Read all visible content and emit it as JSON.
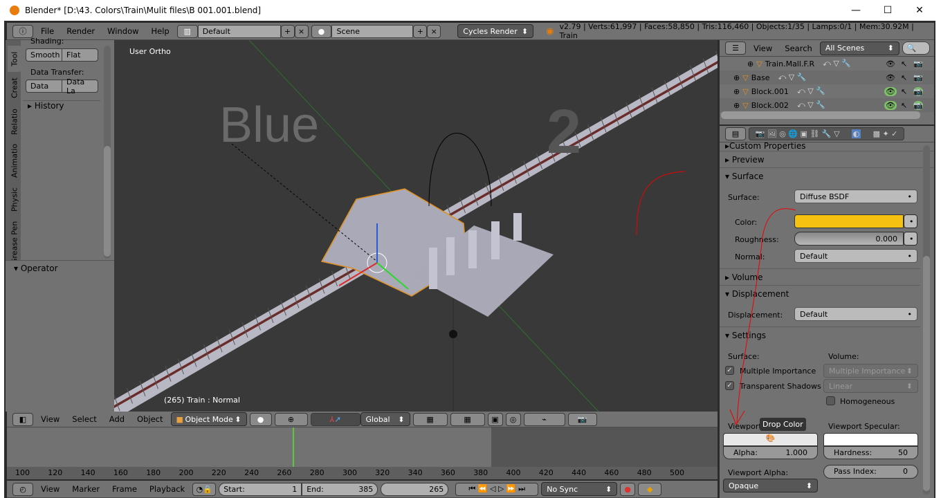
{
  "window": {
    "title": "Blender* [D:\\43. Colors\\Train\\Mulit files\\B 001.001.blend]",
    "minimize": "—",
    "maximize": "☐",
    "close": "✕"
  },
  "info_header": {
    "menus": [
      "File",
      "Render",
      "Window",
      "Help"
    ],
    "layout": "Default",
    "scene": "Scene",
    "engine": "Cycles Render",
    "stats": "v2.79 | Verts:61,997 | Faces:58,850 | Tris:116,460 | Objects:1/35 | Lamps:0/1 | Mem:30.92M | Train"
  },
  "tool_shelf": {
    "tabs": [
      "Tool",
      "Creat",
      "Relatio",
      "Animatio",
      "Physic",
      "Grease Pen"
    ],
    "shading_label": "Shading:",
    "smooth": "Smooth",
    "flat": "Flat",
    "data_transfer_label": "Data Transfer:",
    "data": "Data",
    "data_layers": "Data La",
    "history": "History",
    "operator": "Operator"
  },
  "viewport": {
    "view_label": "User Ortho",
    "object_label": "(265) Train : Normal",
    "text_blue": "Blue",
    "text_num": "2"
  },
  "view3d_header": {
    "menus": [
      "View",
      "Select",
      "Add",
      "Object"
    ],
    "mode": "Object Mode",
    "orientation": "Global"
  },
  "timeline": {
    "ruler": [
      "100",
      "120",
      "140",
      "160",
      "180",
      "200",
      "220",
      "240",
      "260",
      "280",
      "300",
      "320",
      "340",
      "360",
      "380",
      "400",
      "420",
      "440",
      "460",
      "480",
      "500"
    ],
    "menus": [
      "View",
      "Marker",
      "Frame",
      "Playback"
    ],
    "start_label": "Start:",
    "start": "1",
    "end_label": "End:",
    "end": "385",
    "current": "265",
    "sync": "No Sync",
    "current_frame_color": "#5ec63b"
  },
  "outliner": {
    "menus": [
      "View",
      "Search"
    ],
    "filter": "All Scenes",
    "rows": [
      {
        "name": "Train.Mall.F.R",
        "active": false
      },
      {
        "name": "Base",
        "active": false
      },
      {
        "name": "Block.001",
        "active": true
      },
      {
        "name": "Block.002",
        "active": true
      }
    ]
  },
  "properties": {
    "custom_properties": "Custom Properties",
    "preview": "Preview",
    "surface_section": "Surface",
    "surface_label": "Surface:",
    "surface_value": "Diffuse BSDF",
    "color_label": "Color:",
    "color_value": "#f5c211",
    "roughness_label": "Roughness:",
    "roughness_value": "0.000",
    "normal_label": "Normal:",
    "normal_value": "Default",
    "volume": "Volume",
    "displacement_section": "Displacement",
    "displacement_label": "Displacement:",
    "displacement_value": "Default",
    "settings": "Settings",
    "surface_sub": "Surface:",
    "volume_sub": "Volume:",
    "multiple_importance": "Multiple Importance",
    "transparent_shadows": "Transparent Shadows",
    "volume_sampling": "Multiple Importance",
    "volume_interp": "Linear",
    "homogeneous": "Homogeneous",
    "viewport_color": "Viewport",
    "tooltip": "Drop Color",
    "viewport_specular": "Viewport Specular:",
    "alpha_label": "Alpha:",
    "alpha_value": "1.000",
    "hardness_label": "Hardness:",
    "hardness_value": "50",
    "viewport_alpha": "Viewport Alpha:",
    "viewport_alpha_value": "Opaque",
    "pass_index_label": "Pass Index:",
    "pass_index_value": "0"
  }
}
